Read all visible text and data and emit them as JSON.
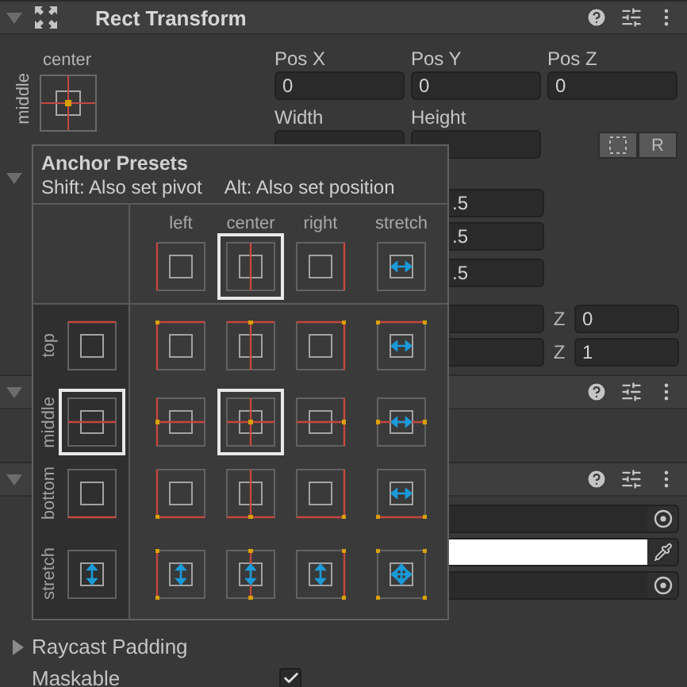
{
  "component": {
    "title": "Rect Transform",
    "expanded": true,
    "anchor": {
      "horizontal": "center",
      "vertical": "middle"
    },
    "position_fields": [
      {
        "label": "Pos X",
        "value": "0"
      },
      {
        "label": "Pos Y",
        "value": "0"
      },
      {
        "label": "Pos Z",
        "value": "0"
      }
    ],
    "size_fields": [
      {
        "label": "Width"
      },
      {
        "label": "Height"
      }
    ],
    "raw_button": {
      "label": "R"
    },
    "foldout": {
      "expanded": true
    },
    "partial_fields": [
      {
        "value": ".5"
      },
      {
        "value": ".5"
      },
      {
        "value": ".5"
      }
    ],
    "xyz_rows": [
      {
        "z_label": "Z",
        "z_value": "0"
      },
      {
        "z_label": "Z",
        "z_value": "1"
      }
    ]
  },
  "components": [
    {
      "expanded": true
    },
    {
      "expanded": true,
      "fields": [
        {
          "kind": "object"
        },
        {
          "kind": "color",
          "color": "#ffffff"
        },
        {
          "kind": "object"
        }
      ]
    }
  ],
  "raycast_padding": {
    "label": "Raycast Padding",
    "expanded": false
  },
  "maskable": {
    "label": "Maskable",
    "checked": true
  },
  "popup": {
    "title": "Anchor Presets",
    "hints": [
      "Shift: Also set pivot",
      "Alt: Also set position"
    ],
    "columns": [
      {
        "label": "left",
        "selected": false
      },
      {
        "label": "center",
        "selected": true
      },
      {
        "label": "right",
        "selected": false
      },
      {
        "label": "stretch",
        "selected": false
      }
    ],
    "rows": [
      {
        "label": "top",
        "selected": false,
        "cells": [
          {
            "selected": false
          },
          {
            "selected": false
          },
          {
            "selected": false
          },
          {
            "selected": false
          }
        ]
      },
      {
        "label": "middle",
        "selected": true,
        "cells": [
          {
            "selected": false
          },
          {
            "selected": true
          },
          {
            "selected": false
          },
          {
            "selected": false
          }
        ]
      },
      {
        "label": "bottom",
        "selected": false,
        "cells": [
          {
            "selected": false
          },
          {
            "selected": false
          },
          {
            "selected": false
          },
          {
            "selected": false
          }
        ]
      },
      {
        "label": "stretch",
        "selected": false,
        "cells": [
          {
            "selected": false
          },
          {
            "selected": false
          },
          {
            "selected": false
          },
          {
            "selected": false
          }
        ]
      }
    ]
  }
}
